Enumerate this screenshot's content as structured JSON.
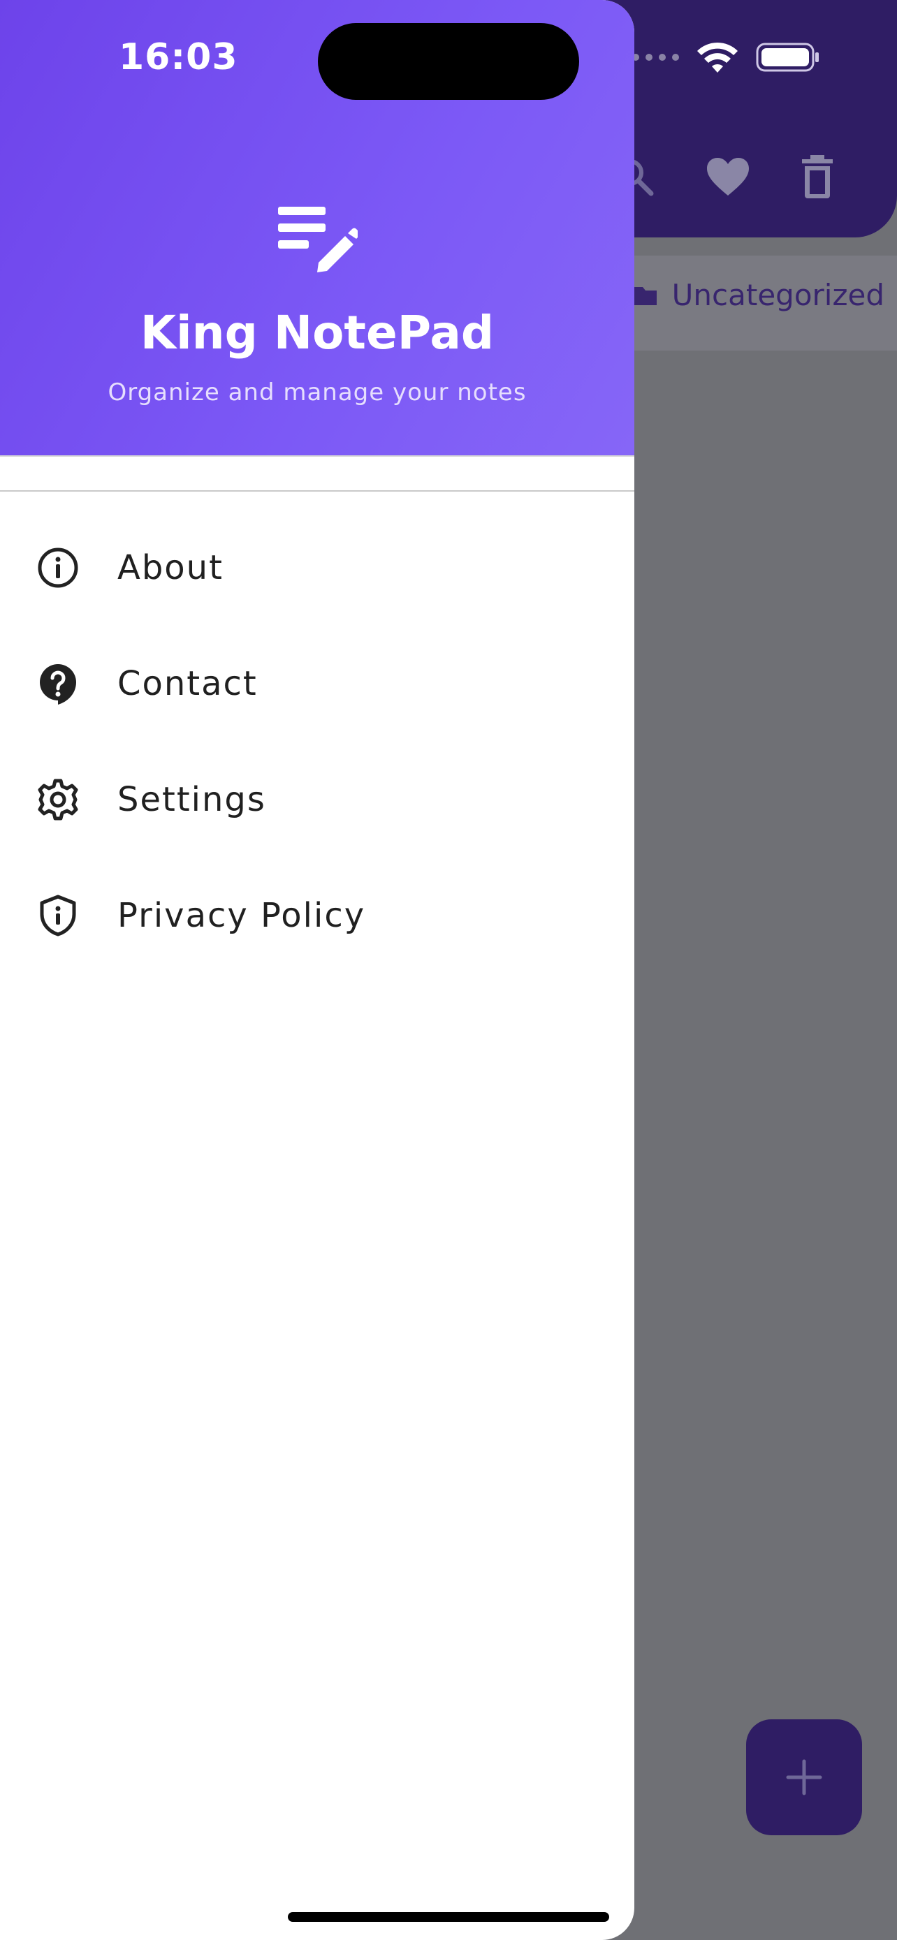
{
  "status_bar": {
    "time": "16:03"
  },
  "drawer": {
    "header": {
      "logo_icon": "notes-edit-icon",
      "title": "King NotePad",
      "subtitle": "Organize and manage your notes"
    },
    "items": [
      {
        "label": "About",
        "icon": "info-icon"
      },
      {
        "label": "Contact",
        "icon": "help-bubble-icon"
      },
      {
        "label": "Settings",
        "icon": "gear-icon"
      },
      {
        "label": "Privacy Policy",
        "icon": "shield-icon"
      }
    ]
  },
  "background_app": {
    "action_icons": [
      "search-icon",
      "heart-icon",
      "trash-icon"
    ],
    "category_chip": {
      "label": "Uncategorized",
      "icon": "folder-icon"
    },
    "fab_icon": "plus-icon"
  },
  "colors": {
    "header_gradient_start": "#6d43ea",
    "header_gradient_end": "#8666f7",
    "background_appbar": "#2f1d64",
    "scrim": "#6f7075",
    "menu_text": "#202020"
  }
}
